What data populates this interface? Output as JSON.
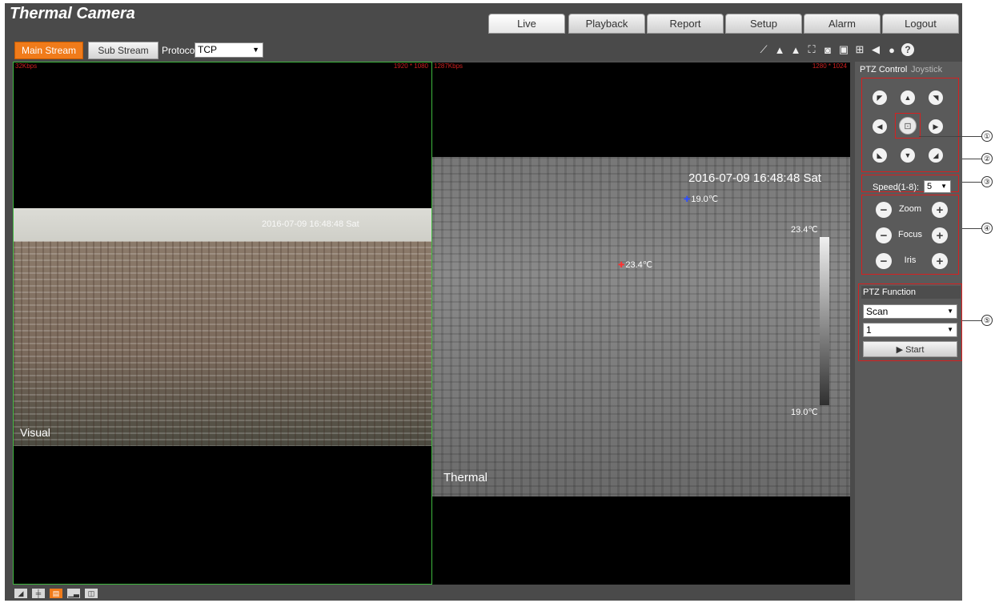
{
  "header": {
    "brand": "Thermal Camera",
    "nav": [
      "Live",
      "Playback",
      "Report",
      "Setup",
      "Alarm",
      "Logout"
    ]
  },
  "toolbar": {
    "main_stream": "Main Stream",
    "sub_stream": "Sub Stream",
    "protocol_label": "Protocol",
    "protocol_value": "TCP"
  },
  "visual": {
    "bitrate": "32Kbps",
    "resolution": "1920 * 1080",
    "timestamp": "2016-07-09 16:48:48 Sat",
    "label": "Visual"
  },
  "thermal": {
    "bitrate": "1287Kbps",
    "resolution": "1280 * 1024",
    "timestamp": "2016-07-09 16:48:48 Sat",
    "spot_low": "19.0℃",
    "spot_high": "23.4℃",
    "scale_max": "23.4℃",
    "scale_min": "19.0℃",
    "label": "Thermal"
  },
  "ptz": {
    "tab_control": "PTZ Control",
    "tab_joystick": "Joystick",
    "speed_label": "Speed(1-8):",
    "speed_value": "5",
    "zoom": "Zoom",
    "focus": "Focus",
    "iris": "Iris",
    "function_title": "PTZ Function",
    "function_value": "Scan",
    "function_number": "1",
    "start_label": "▶ Start"
  },
  "callouts": [
    "①",
    "②",
    "③",
    "④",
    "⑤"
  ],
  "colors": {
    "accent": "#f07b1a",
    "panel": "#4a4a4a",
    "highlight": "#d62020",
    "active_pane": "#3fb83f"
  }
}
